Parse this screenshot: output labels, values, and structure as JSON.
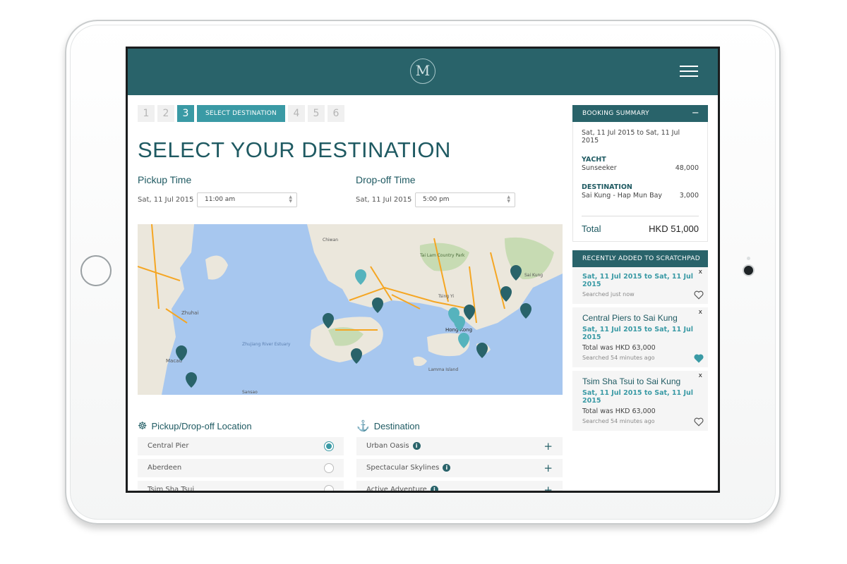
{
  "app": {
    "logo_letter": "M"
  },
  "steps": {
    "items": [
      "1",
      "2",
      "3",
      "4",
      "5",
      "6"
    ],
    "active_label": "SELECT DESTINATION"
  },
  "page": {
    "title": "SELECT YOUR DESTINATION"
  },
  "pickup": {
    "label": "Pickup Time",
    "date": "Sat, 11 Jul 2015",
    "time": "11:00 am"
  },
  "dropoff": {
    "label": "Drop-off Time",
    "date": "Sat, 11 Jul 2015",
    "time": "5:00 pm"
  },
  "map": {
    "labels": [
      "Zhuhai",
      "Macau",
      "Zhujiang River Estuary",
      "Hong Kong",
      "Lamma Island",
      "Tai Lam Country Park",
      "Tsing Yi",
      "Sai Kung",
      "Sansao",
      "Chiwan"
    ],
    "water_color": "#a7c7ef",
    "land_color": "#ebe7dc",
    "park_color": "#c7dbb3",
    "road_color": "#f5a623"
  },
  "locations": {
    "title": "Pickup/Drop-off Location",
    "items": [
      {
        "label": "Central Pier",
        "selected": true
      },
      {
        "label": "Aberdeen",
        "selected": false
      },
      {
        "label": "Tsim Sha Tsui",
        "selected": false
      }
    ]
  },
  "destinations": {
    "title": "Destination",
    "items": [
      {
        "label": "Urban Oasis"
      },
      {
        "label": "Spectacular Skylines"
      },
      {
        "label": "Active Adventure"
      }
    ]
  },
  "summary": {
    "title": "BOOKING SUMMARY",
    "toggle": "−",
    "dates": "Sat, 11 Jul 2015 to Sat, 11 Jul 2015",
    "yacht_label": "YACHT",
    "yacht_name": "Sunseeker",
    "yacht_price": "48,000",
    "dest_label": "DESTINATION",
    "dest_name": "Sai Kung - Hap Mun Bay",
    "dest_price": "3,000",
    "total_label": "Total",
    "total_value": "HKD 51,000"
  },
  "scratchpad": {
    "title": "RECENTLY ADDED TO SCRATCHPAD",
    "close_glyph": "x",
    "items": [
      {
        "route": "",
        "dates": "Sat, 11 Jul 2015 to Sat, 11 Jul 2015",
        "total": "",
        "meta": "Searched just now",
        "favorited": false
      },
      {
        "route": "Central Piers to Sai Kung",
        "dates": "Sat, 11 Jul 2015 to Sat, 11 Jul 2015",
        "total": "Total was HKD 63,000",
        "meta": "Searched 54 minutes ago",
        "favorited": true
      },
      {
        "route": "Tsim Sha Tsui to Sai Kung",
        "dates": "Sat, 11 Jul 2015 to Sat, 11 Jul 2015",
        "total": "Total was HKD 63,000",
        "meta": "Searched 54 minutes ago",
        "favorited": false
      }
    ]
  },
  "colors": {
    "brand": "#29636a",
    "accent": "#3a9aa5"
  }
}
